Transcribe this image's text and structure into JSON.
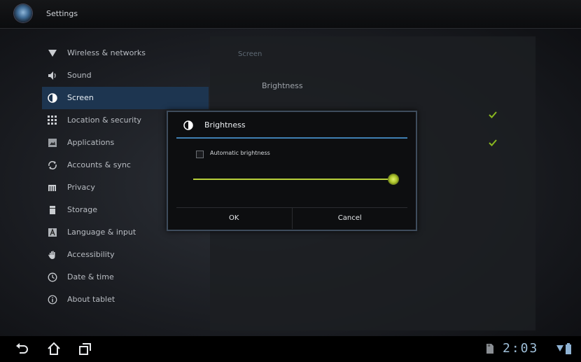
{
  "window": {
    "title": "Settings",
    "app_icon": "settings-app-icon"
  },
  "menu": {
    "items": [
      {
        "label": "Wireless & networks",
        "icon": "wifi-icon"
      },
      {
        "label": "Sound",
        "icon": "speaker-icon"
      },
      {
        "label": "Screen",
        "icon": "screen-icon",
        "selected": true
      },
      {
        "label": "Location & security",
        "icon": "location-grid-icon"
      },
      {
        "label": "Applications",
        "icon": "applications-icon"
      },
      {
        "label": "Accounts & sync",
        "icon": "sync-icon"
      },
      {
        "label": "Privacy",
        "icon": "privacy-icon"
      },
      {
        "label": "Storage",
        "icon": "storage-icon"
      },
      {
        "label": "Language & input",
        "icon": "language-icon"
      },
      {
        "label": "Accessibility",
        "icon": "hand-icon"
      },
      {
        "label": "Date & time",
        "icon": "clock-icon"
      },
      {
        "label": "About tablet",
        "icon": "info-icon"
      }
    ]
  },
  "detail": {
    "section_header": "Screen",
    "pref_title": "Brightness"
  },
  "dialog": {
    "title": "Brightness",
    "title_icon": "brightness-icon",
    "auto_label": "Automatic brightness",
    "auto_checked": false,
    "brightness_level": 0.98,
    "ok_label": "OK",
    "cancel_label": "Cancel"
  },
  "system_bar": {
    "time": "2:03",
    "nav": [
      "back-icon",
      "home-icon",
      "recent-apps-icon"
    ],
    "status_icons": [
      "sd-card-icon",
      "wifi-signal-icon",
      "battery-icon"
    ]
  },
  "colors": {
    "accent_blue": "#3f7fb2",
    "selection": "#1d3550",
    "slider_green": "#b7cf3a",
    "checkmark_green": "#8ab81f"
  }
}
